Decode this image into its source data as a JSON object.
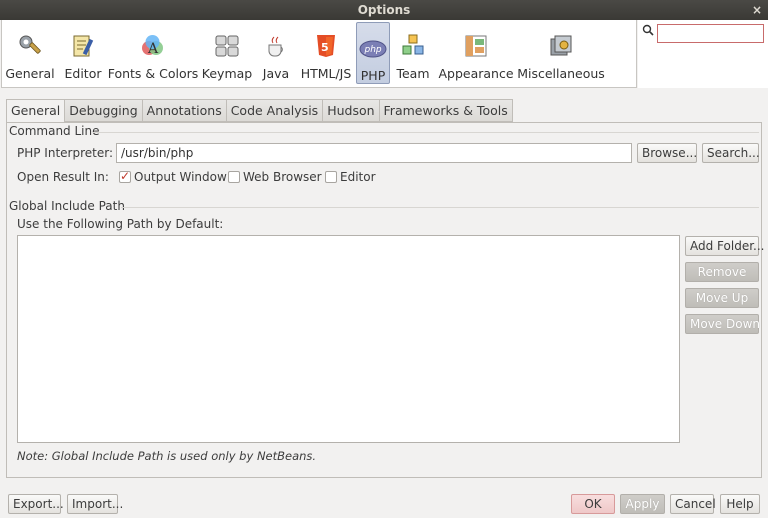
{
  "window": {
    "title": "Options",
    "close_glyph": "×"
  },
  "categories": [
    {
      "label": "General",
      "icon": "general-icon"
    },
    {
      "label": "Editor",
      "icon": "editor-icon"
    },
    {
      "label": "Fonts & Colors",
      "icon": "fonts-colors-icon"
    },
    {
      "label": "Keymap",
      "icon": "keymap-icon"
    },
    {
      "label": "Java",
      "icon": "java-icon"
    },
    {
      "label": "HTML/JS",
      "icon": "html5-icon"
    },
    {
      "label": "PHP",
      "icon": "php-icon",
      "active": true
    },
    {
      "label": "Team",
      "icon": "team-icon"
    },
    {
      "label": "Appearance",
      "icon": "appearance-icon"
    },
    {
      "label": "Miscellaneous",
      "icon": "miscellaneous-icon"
    }
  ],
  "search": {
    "value": "",
    "placeholder": ""
  },
  "tabs": [
    {
      "label": "General",
      "active": true
    },
    {
      "label": "Debugging"
    },
    {
      "label": "Annotations"
    },
    {
      "label": "Code Analysis"
    },
    {
      "label": "Hudson"
    },
    {
      "label": "Frameworks & Tools"
    }
  ],
  "command_line": {
    "section_title": "Command Line",
    "interpreter_label": "PHP Interpreter:",
    "interpreter_value": "/usr/bin/php",
    "browse_label": "Browse...",
    "search_label": "Search...",
    "open_result_label": "Open Result In:",
    "options": [
      {
        "label": "Output Window",
        "checked": true
      },
      {
        "label": "Web Browser",
        "checked": false
      },
      {
        "label": "Editor",
        "checked": false
      }
    ]
  },
  "include_path": {
    "section_title": "Global Include Path",
    "use_label": "Use the Following Path by Default:",
    "add_folder_label": "Add Folder...",
    "remove_label": "Remove",
    "move_up_label": "Move Up",
    "move_down_label": "Move Down",
    "note": "Note: Global Include Path is used only by NetBeans."
  },
  "footer": {
    "export_label": "Export...",
    "import_label": "Import...",
    "ok_label": "OK",
    "apply_label": "Apply",
    "cancel_label": "Cancel",
    "help_label": "Help"
  },
  "colors": {
    "accent_check": "#c0392b",
    "active_tab_bg": "#c3cde0",
    "search_border": "#c86b6b"
  }
}
